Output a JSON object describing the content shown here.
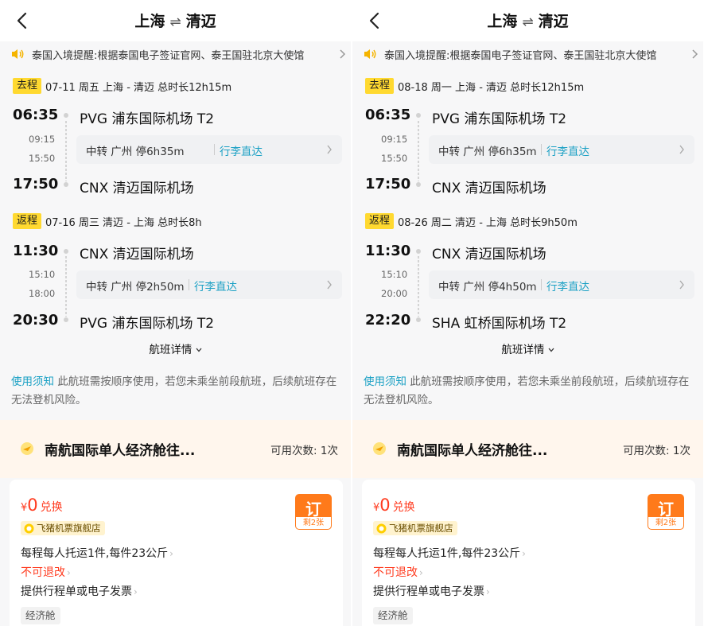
{
  "panels": [
    {
      "nav": {
        "from": "上海",
        "to": "清迈"
      },
      "notice": "泰国入境提醒:根据泰国电子签证官网、泰王国驻北京大使馆",
      "outbound": {
        "tag": "去程",
        "info": "07-11 周五 上海 - 清迈 总时长12h15m",
        "dep_time": "06:35",
        "dep_airport": "PVG 浦东国际机场 T2",
        "arr_time": "17:50",
        "arr_airport": "CNX 清迈国际机场",
        "stop_arr": "09:15",
        "stop_dep": "15:50",
        "transfer": "中转 广州 停6h35m",
        "luggage": "行李直达"
      },
      "return": {
        "tag": "返程",
        "info": "07-16 周三 清迈 - 上海 总时长8h",
        "dep_time": "11:30",
        "dep_airport": "CNX 清迈国际机场",
        "arr_time": "20:30",
        "arr_airport": "PVG 浦东国际机场 T2",
        "stop_arr": "15:10",
        "stop_dep": "18:00",
        "transfer": "中转 广州 停2h50m",
        "luggage": "行李直达"
      },
      "details": "航班详情",
      "usage": {
        "highlight": "使用须知",
        "text": " 此航班需按顺序使用，若您未乘坐前段航班，后续航班存在无法登机风险。"
      },
      "product": {
        "name": "南航国际单人经济舱往...",
        "count": "可用次数: 1次"
      },
      "card": {
        "price_symbol": "¥",
        "price_value": "0",
        "price_label": "兑换",
        "shop": "飞猪机票旗舰店",
        "book_label": "订",
        "book_remain": "剩2张",
        "rule1": "每程每人托运1件,每件23公斤",
        "rule2": "不可退改",
        "rule3": "提供行程单或电子发票",
        "cabin": "经济舱"
      }
    },
    {
      "nav": {
        "from": "上海",
        "to": "清迈"
      },
      "notice": "泰国入境提醒:根据泰国电子签证官网、泰王国驻北京大使馆",
      "outbound": {
        "tag": "去程",
        "info": "08-18 周一 上海 - 清迈 总时长12h15m",
        "dep_time": "06:35",
        "dep_airport": "PVG 浦东国际机场 T2",
        "arr_time": "17:50",
        "arr_airport": "CNX 清迈国际机场",
        "stop_arr": "09:15",
        "stop_dep": "15:50",
        "transfer": "中转 广州 停6h35m",
        "luggage": "行李直达"
      },
      "return": {
        "tag": "返程",
        "info": "08-26 周二 清迈 - 上海 总时长9h50m",
        "dep_time": "11:30",
        "dep_airport": "CNX 清迈国际机场",
        "arr_time": "22:20",
        "arr_airport": "SHA 虹桥国际机场 T2",
        "stop_arr": "15:10",
        "stop_dep": "20:00",
        "transfer": "中转 广州 停4h50m",
        "luggage": "行李直达"
      },
      "details": "航班详情",
      "usage": {
        "highlight": "使用须知",
        "text": " 此航班需按顺序使用，若您未乘坐前段航班，后续航班存在无法登机风险。"
      },
      "product": {
        "name": "南航国际单人经济舱往...",
        "count": "可用次数: 1次"
      },
      "card": {
        "price_symbol": "¥",
        "price_value": "0",
        "price_label": "兑换",
        "shop": "飞猪机票旗舰店",
        "book_label": "订",
        "book_remain": "剩2张",
        "rule1": "每程每人托运1件,每件23公斤",
        "rule2": "不可退改",
        "rule3": "提供行程单或电子发票",
        "cabin": "经济舱"
      }
    }
  ],
  "colors": {
    "accent": "#1aa0c4",
    "tag": "#ffd930",
    "price": "#ff3b1f",
    "book": "#ff7a1a",
    "band": "#fff6ed"
  }
}
